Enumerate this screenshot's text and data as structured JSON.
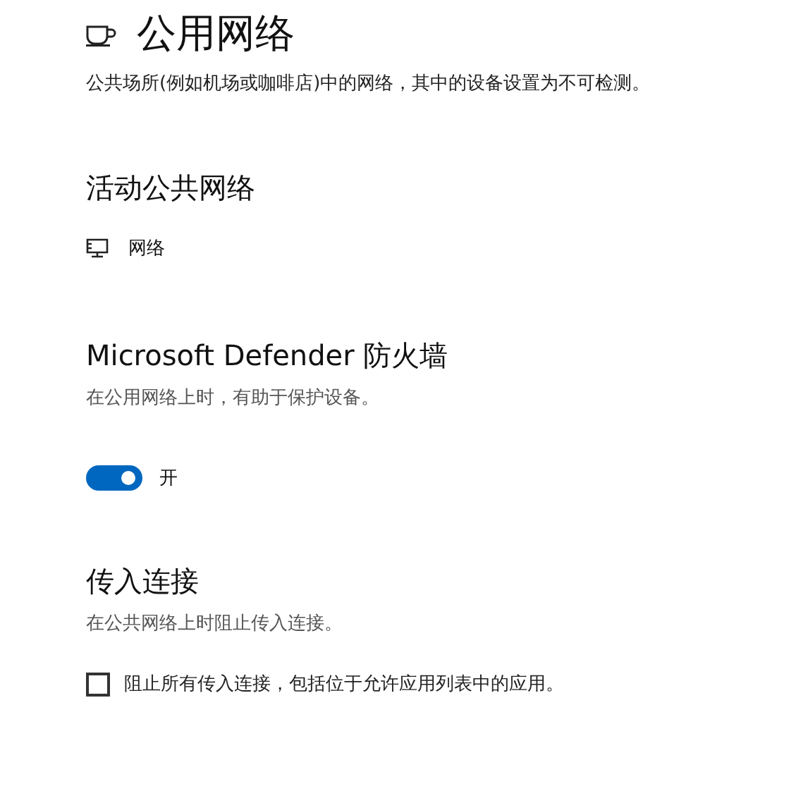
{
  "page": {
    "title": "公用网络",
    "description": "公共场所(例如机场或咖啡店)中的网络，其中的设备设置为不可检测。"
  },
  "active_networks": {
    "heading": "活动公共网络",
    "items": [
      {
        "label": "网络"
      }
    ]
  },
  "firewall": {
    "heading": "Microsoft Defender 防火墙",
    "description": "在公用网络上时，有助于保护设备。",
    "toggle": {
      "on": true,
      "label": "开"
    }
  },
  "incoming": {
    "heading": "传入连接",
    "description": "在公共网络上时阻止传入连接。",
    "checkbox": {
      "checked": false,
      "label": "阻止所有传入连接，包括位于允许应用列表中的应用。"
    }
  }
}
